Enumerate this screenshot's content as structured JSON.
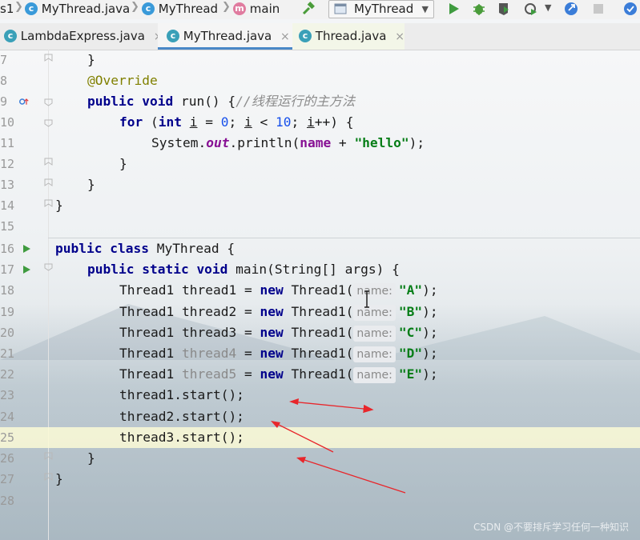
{
  "breadcrumb": {
    "partial": "s1",
    "file": "MyThread.java",
    "class": "MyThread",
    "method": "main"
  },
  "toolbar": {
    "run_config": "MyThread",
    "icons": [
      "hammer-icon",
      "run-icon",
      "debug-icon",
      "coverage-icon",
      "profile-icon",
      "chevron-down-icon",
      "help-icon",
      "stop-icon",
      "update-icon"
    ]
  },
  "tabs": [
    {
      "label": "LambdaExpress.java",
      "close": "×"
    },
    {
      "label": "MyThread.java",
      "close": "×",
      "active": true
    },
    {
      "label": "Thread.java",
      "close": "×"
    }
  ],
  "line_numbers": [
    "7",
    "8",
    "9",
    "10",
    "11",
    "12",
    "13",
    "14",
    "15",
    "16",
    "17",
    "18",
    "19",
    "20",
    "21",
    "22",
    "23",
    "24",
    "25",
    "26",
    "27",
    "28"
  ],
  "code": {
    "l7": "}",
    "l8_annotation": "@Override",
    "l9_kw": "public void",
    "l9_sig": "run() {",
    "l9_comment": "//线程运行的主方法",
    "l10_for": "for",
    "l10_open": "(",
    "l10_int": "int",
    "l10_i1": "i",
    "l10_eq": " = ",
    "l10_zero": "0",
    "l10_semi1": "; ",
    "l10_i2": "i",
    "l10_lt": " < ",
    "l10_ten": "10",
    "l10_semi2": "; ",
    "l10_i3": "i",
    "l10_inc": "++) {",
    "l11_sys": "System.",
    "l11_out": "out",
    "l11_print": ".println(",
    "l11_name": "name",
    "l11_plus": " + ",
    "l11_hello": "\"hello\"",
    "l11_end": ");",
    "l12": "}",
    "l13": "}",
    "l14": "}",
    "l16_kw": "public class",
    "l16_rest": " MyThread {",
    "l17_kw": "public static void",
    "l17_rest": " main(String[] args) {",
    "threads": [
      {
        "type": "Thread1 ",
        "var": "thread1",
        "eq": " = ",
        "new": "new",
        "ctor": " Thread1(",
        "hint": "name:",
        "arg": "\"A\"",
        "end": ");",
        "unused": false
      },
      {
        "type": "Thread1 ",
        "var": "thread2",
        "eq": " = ",
        "new": "new",
        "ctor": " Thread1(",
        "hint": "name:",
        "arg": "\"B\"",
        "end": ");",
        "unused": false
      },
      {
        "type": "Thread1 ",
        "var": "thread3",
        "eq": " = ",
        "new": "new",
        "ctor": " Thread1(",
        "hint": "name:",
        "arg": "\"C\"",
        "end": ");",
        "unused": false
      },
      {
        "type": "Thread1 ",
        "var": "thread4",
        "eq": " = ",
        "new": "new",
        "ctor": " Thread1(",
        "hint": "name:",
        "arg": "\"D\"",
        "end": ");",
        "unused": true
      },
      {
        "type": "Thread1 ",
        "var": "thread5",
        "eq": " = ",
        "new": "new",
        "ctor": " Thread1(",
        "hint": "name:",
        "arg": "\"E\"",
        "end": ");",
        "unused": true
      }
    ],
    "l23": "thread1.start();",
    "l24": "thread2.start();",
    "l25": "thread3.start();",
    "l26": "}",
    "l27": "}"
  },
  "colors": {
    "keyword": "#00008b",
    "string": "#067d17",
    "number": "#1750eb",
    "annotation": "#808000",
    "field": "#871094",
    "arrow": "#e8262b",
    "highlight": "#fcfad6"
  },
  "watermark": "CSDN @不要排斥学习任何一种知识"
}
